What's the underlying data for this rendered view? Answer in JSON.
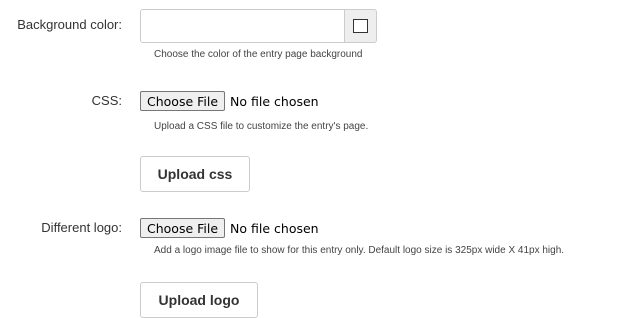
{
  "background_color": {
    "label": "Background color:",
    "value": "",
    "swatch_color": "#ffffff",
    "help": "Choose the color of the entry page background"
  },
  "css": {
    "label": "CSS:",
    "choose_file_label": "Choose File",
    "file_status": "No file chosen",
    "help": "Upload a CSS file to customize the entry's page.",
    "upload_label": "Upload css"
  },
  "logo": {
    "label": "Different logo:",
    "choose_file_label": "Choose File",
    "file_status": "No file chosen",
    "help": "Add a logo image file to show for this entry only. Default logo size is 325px wide X 41px high.",
    "upload_label": "Upload logo"
  }
}
